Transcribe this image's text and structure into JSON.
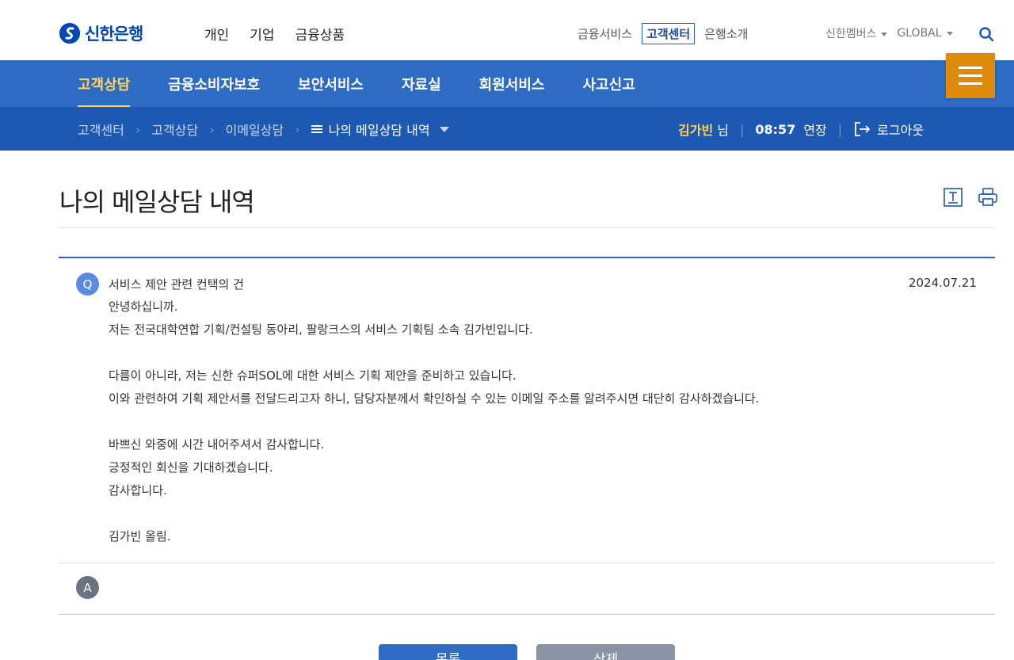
{
  "brand": {
    "name": "신한은행",
    "color": "#0046b5"
  },
  "main_nav": [
    "개인",
    "기업",
    "금융상품"
  ],
  "util_nav": [
    {
      "label": "금융서비스",
      "active": false
    },
    {
      "label": "고객센터",
      "active": true
    },
    {
      "label": "은행소개",
      "active": false
    }
  ],
  "member_nav": {
    "members": "신한멤버스",
    "global": "GLOBAL"
  },
  "blue_nav": {
    "items": [
      "고객상담",
      "금융소비자보호",
      "보안서비스",
      "자료실",
      "회원서비스",
      "사고신고"
    ],
    "selected_index": 0,
    "color": "#2e6cc4",
    "accent": "#ffd45a"
  },
  "menu_button": {
    "icon": "hamburger-menu-icon",
    "color": "#de8a0b"
  },
  "breadcrumb": {
    "items": [
      "고객센터",
      "고객상담",
      "이메일상담"
    ],
    "current": "나의 메일상담 내역"
  },
  "user": {
    "name": "김가빈",
    "suffix": "님",
    "session_time": "08:57",
    "extend": "연장",
    "logout": "로그아웃"
  },
  "page": {
    "title": "나의 메일상담 내역"
  },
  "question": {
    "badge": "Q",
    "subject": "서비스 제안 관련 컨택의 건",
    "date": "2024.07.21",
    "body": [
      "안녕하십니까.",
      "저는 전국대학연합 기획/컨설팅 동아리, 팔랑크스의 서비스 기획팀 소속 김가빈입니다.",
      "",
      "다름이 아니라, 저는 신한 슈퍼SOL에 대한 서비스 기획 제안을 준비하고 있습니다.",
      "이와 관련하여 기획 제안서를 전달드리고자 하니, 담당자분께서 확인하실 수 있는 이메일 주소를 알려주시면 대단히 감사하겠습니다.",
      "",
      "바쁘신 와중에 시간 내어주셔서 감사합니다.",
      "긍정적인 회신을 기대하겠습니다.",
      "감사합니다.",
      "",
      "김가빈 올림."
    ]
  },
  "answer": {
    "badge": "A"
  },
  "buttons": {
    "list": "목록",
    "delete": "삭제"
  }
}
